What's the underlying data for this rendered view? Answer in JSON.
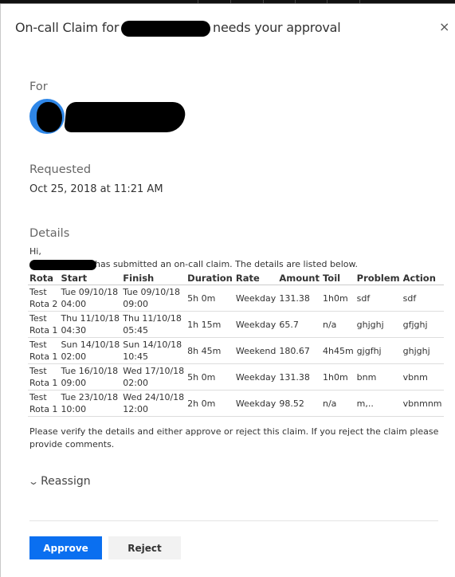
{
  "dialog": {
    "title_prefix": "On-call Claim for",
    "title_suffix": "needs your approval",
    "close_icon": "×"
  },
  "for_section": {
    "label": "For"
  },
  "requested": {
    "label": "Requested",
    "value": "Oct 25, 2018 at 11:21 AM"
  },
  "details": {
    "label": "Details",
    "greeting": "Hi,",
    "intro": "has submitted an on-call claim. The details are listed below.",
    "columns": [
      "Rota",
      "Start",
      "Finish",
      "Duration",
      "Rate",
      "Amount",
      "Toil",
      "Problem",
      "Action"
    ],
    "rows": [
      {
        "rota": [
          "Test",
          "Rota 2"
        ],
        "start": [
          "Tue 09/10/18",
          "04:00"
        ],
        "finish": [
          "Tue 09/10/18",
          "09:00"
        ],
        "duration": "5h 0m",
        "rate": "Weekday",
        "amount": "131.38",
        "toil": "1h0m",
        "problem": "sdf",
        "action": "sdf"
      },
      {
        "rota": [
          "Test",
          "Rota 1"
        ],
        "start": [
          "Thu 11/10/18",
          "04:30"
        ],
        "finish": [
          "Thu 11/10/18",
          "05:45"
        ],
        "duration": "1h 15m",
        "rate": "Weekday",
        "amount": "65.7",
        "toil": "n/a",
        "problem": "ghjghj",
        "action": "gfjghj"
      },
      {
        "rota": [
          "Test",
          "Rota 1"
        ],
        "start": [
          "Sun 14/10/18",
          "02:00"
        ],
        "finish": [
          "Sun 14/10/18",
          "10:45"
        ],
        "duration": "8h 45m",
        "rate": "Weekend",
        "amount": "180.67",
        "toil": "4h45m",
        "problem": "gjgfhj",
        "action": "ghjghj"
      },
      {
        "rota": [
          "Test",
          "Rota 1"
        ],
        "start": [
          "Tue 16/10/18",
          "09:00"
        ],
        "finish": [
          "Wed 17/10/18",
          "02:00"
        ],
        "duration": "5h 0m",
        "rate": "Weekday",
        "amount": "131.38",
        "toil": "1h0m",
        "problem": "bnm",
        "action": "vbnm"
      },
      {
        "rota": [
          "Test",
          "Rota 1"
        ],
        "start": [
          "Tue 23/10/18",
          "10:00"
        ],
        "finish": [
          "Wed 24/10/18",
          "12:00"
        ],
        "duration": "2h 0m",
        "rate": "Weekday",
        "amount": "98.52",
        "toil": "n/a",
        "problem": "m,..",
        "action": "vbnmnm"
      }
    ],
    "footer": "Please verify the details and either approve or reject this claim. If you reject the claim please provide comments."
  },
  "reassign": {
    "label": "Reassign",
    "icon": "chevron-down-icon"
  },
  "actions": {
    "approve_label": "Approve",
    "reject_label": "Reject",
    "approve_color": "#0a6ff0"
  }
}
